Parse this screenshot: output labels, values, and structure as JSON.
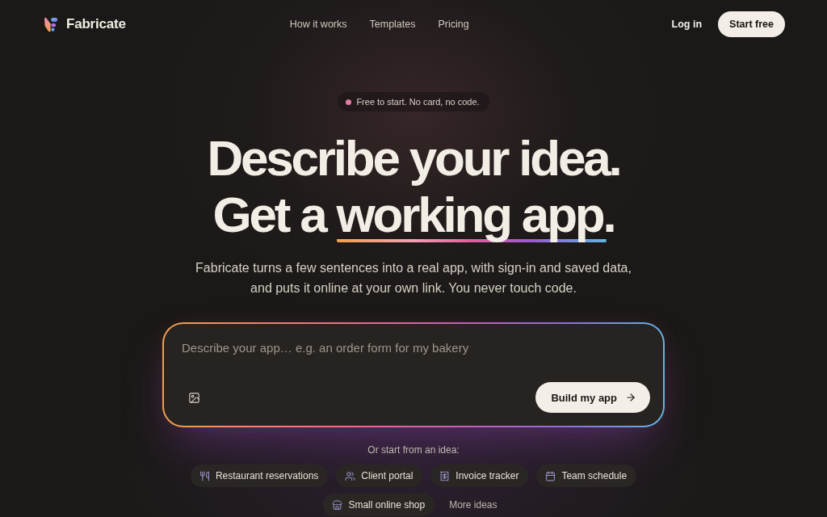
{
  "nav": {
    "brand": "Fabricate",
    "links": [
      "How it works",
      "Templates",
      "Pricing"
    ],
    "login": "Log in",
    "cta": "Start free"
  },
  "hero": {
    "badge": "Free to start. No card, no code.",
    "headline": [
      {
        "segments": [
          {
            "text": "Describe your idea.",
            "underlined": false
          }
        ]
      },
      {
        "segments": [
          {
            "text": "Get a ",
            "underlined": false
          },
          {
            "text": "working app.",
            "underlined": true
          }
        ]
      }
    ],
    "subtitle": "Fabricate turns a few sentences into a real app, with sign-in and saved data, and puts it online at your own link. You never touch code.",
    "prompt": {
      "placeholder": "Describe your app… e.g. an order form for my bakery",
      "submit": "Build my app"
    },
    "ideas": {
      "label": "Or start from an idea:",
      "chips": [
        {
          "label": "Restaurant reservations",
          "kind": "template"
        },
        {
          "label": "Client portal",
          "kind": "template"
        },
        {
          "label": "Invoice tracker",
          "kind": "template"
        },
        {
          "label": "Team schedule",
          "kind": "template"
        },
        {
          "label": "Small online shop",
          "kind": "template"
        },
        {
          "label": "More ideas",
          "kind": "more"
        }
      ]
    }
  }
}
